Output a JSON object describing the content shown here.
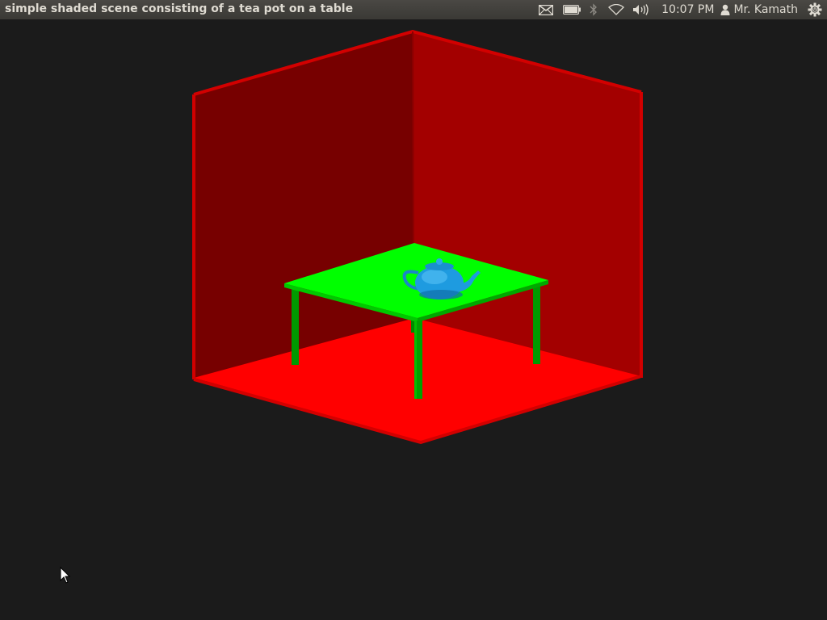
{
  "window": {
    "title": "simple shaded scene consisting of a tea pot on a table"
  },
  "panel": {
    "indicators": [
      "mail-icon",
      "battery-icon",
      "bluetooth-icon",
      "wifi-icon",
      "volume-icon"
    ],
    "clock": "10:07 PM",
    "user_name": "Mr. Kamath",
    "session_icon": "power-gear-icon"
  },
  "scene": {
    "objects": [
      "room-floor",
      "room-left-wall",
      "room-right-wall",
      "table",
      "teapot"
    ],
    "colors": {
      "background": "#1b1b1b",
      "floor": "#ff0000",
      "left_wall": "#7a0000",
      "right_wall": "#a30000",
      "edges": "#c00000",
      "table_top": "#00ff00",
      "table_legs": "#00a000",
      "teapot": "#1e9be0"
    }
  }
}
